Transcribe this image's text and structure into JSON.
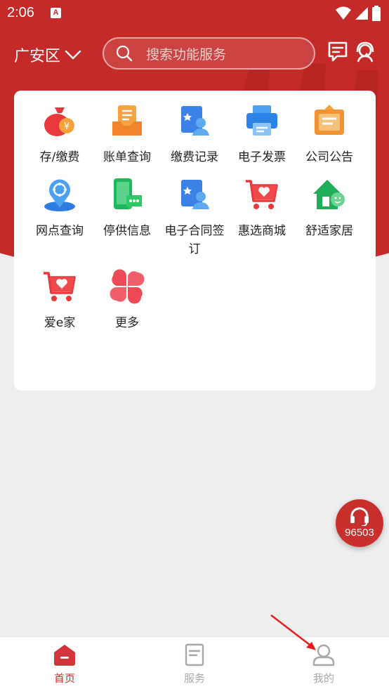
{
  "status": {
    "time": "2:06",
    "notification": "A"
  },
  "header": {
    "region": "广安区",
    "search_placeholder": "搜索功能服务"
  },
  "grid": [
    {
      "label": "存/缴费",
      "icon": "money-bag-icon"
    },
    {
      "label": "账单查询",
      "icon": "bill-inbox-icon"
    },
    {
      "label": "缴费记录",
      "icon": "payment-record-icon"
    },
    {
      "label": "电子发票",
      "icon": "printer-icon"
    },
    {
      "label": "公司公告",
      "icon": "announcement-icon"
    },
    {
      "label": "网点查询",
      "icon": "location-pin-icon"
    },
    {
      "label": "停供信息",
      "icon": "phone-message-icon"
    },
    {
      "label": "电子合同签订",
      "icon": "contract-icon"
    },
    {
      "label": "惠选商城",
      "icon": "shopping-cart-icon"
    },
    {
      "label": "舒适家居",
      "icon": "smart-home-icon"
    },
    {
      "label": "爱e家",
      "icon": "heart-cart-icon"
    },
    {
      "label": "更多",
      "icon": "more-clover-icon"
    }
  ],
  "hotline": {
    "number": "96503"
  },
  "tabs": [
    {
      "label": "首页",
      "icon": "home-icon"
    },
    {
      "label": "服务",
      "icon": "service-doc-icon"
    },
    {
      "label": "我的",
      "icon": "profile-icon"
    }
  ],
  "colors": {
    "primary": "#c42a27",
    "background": "#efeeef"
  }
}
